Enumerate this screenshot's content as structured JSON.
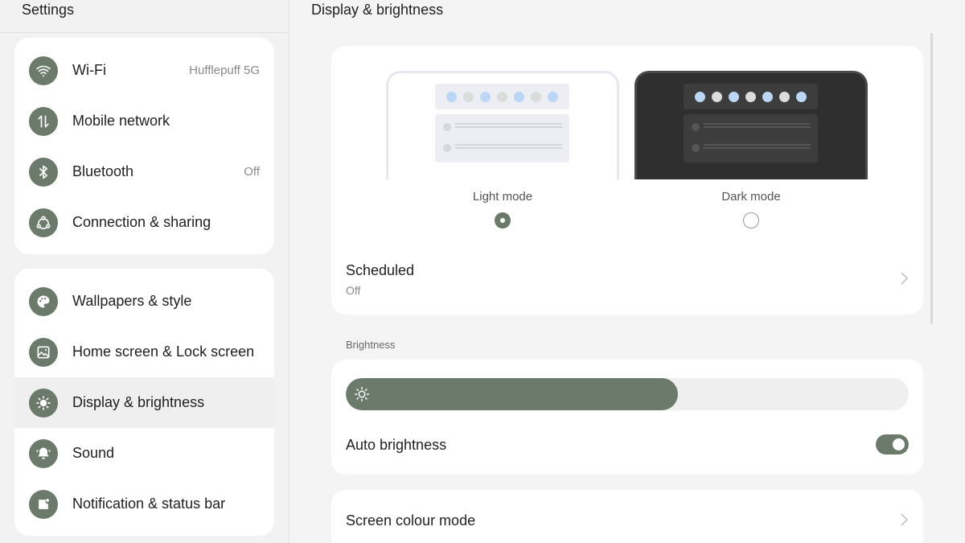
{
  "left": {
    "title": "Settings",
    "groups": [
      {
        "items": [
          {
            "label": "Wi-Fi",
            "value": "Hufflepuff 5G",
            "icon": "wifi-icon"
          },
          {
            "label": "Mobile network",
            "value": "",
            "icon": "mobile-data-icon"
          },
          {
            "label": "Bluetooth",
            "value": "Off",
            "icon": "bluetooth-icon"
          },
          {
            "label": "Connection & sharing",
            "value": "",
            "icon": "share-icon"
          }
        ]
      },
      {
        "items": [
          {
            "label": "Wallpapers & style",
            "value": "",
            "icon": "palette-icon"
          },
          {
            "label": "Home screen & Lock screen",
            "value": "",
            "icon": "image-icon"
          },
          {
            "label": "Display & brightness",
            "value": "",
            "icon": "sun-icon",
            "selected": true
          },
          {
            "label": "Sound",
            "value": "",
            "icon": "bell-icon"
          },
          {
            "label": "Notification & status bar",
            "value": "",
            "icon": "notification-icon"
          }
        ]
      }
    ]
  },
  "right": {
    "title": "Display & brightness",
    "theme": {
      "light_label": "Light mode",
      "dark_label": "Dark mode",
      "selected": "light"
    },
    "scheduled": {
      "title": "Scheduled",
      "value": "Off"
    },
    "brightness": {
      "section_label": "Brightness",
      "level_percent": 59,
      "auto_label": "Auto brightness",
      "auto_enabled": true
    },
    "colour_mode": {
      "title": "Screen colour mode"
    }
  },
  "colors": {
    "accent": "#6b7a6b",
    "preview_dot_blue": "#bcd7f5",
    "preview_dot_grey": "#dcdcdc"
  }
}
